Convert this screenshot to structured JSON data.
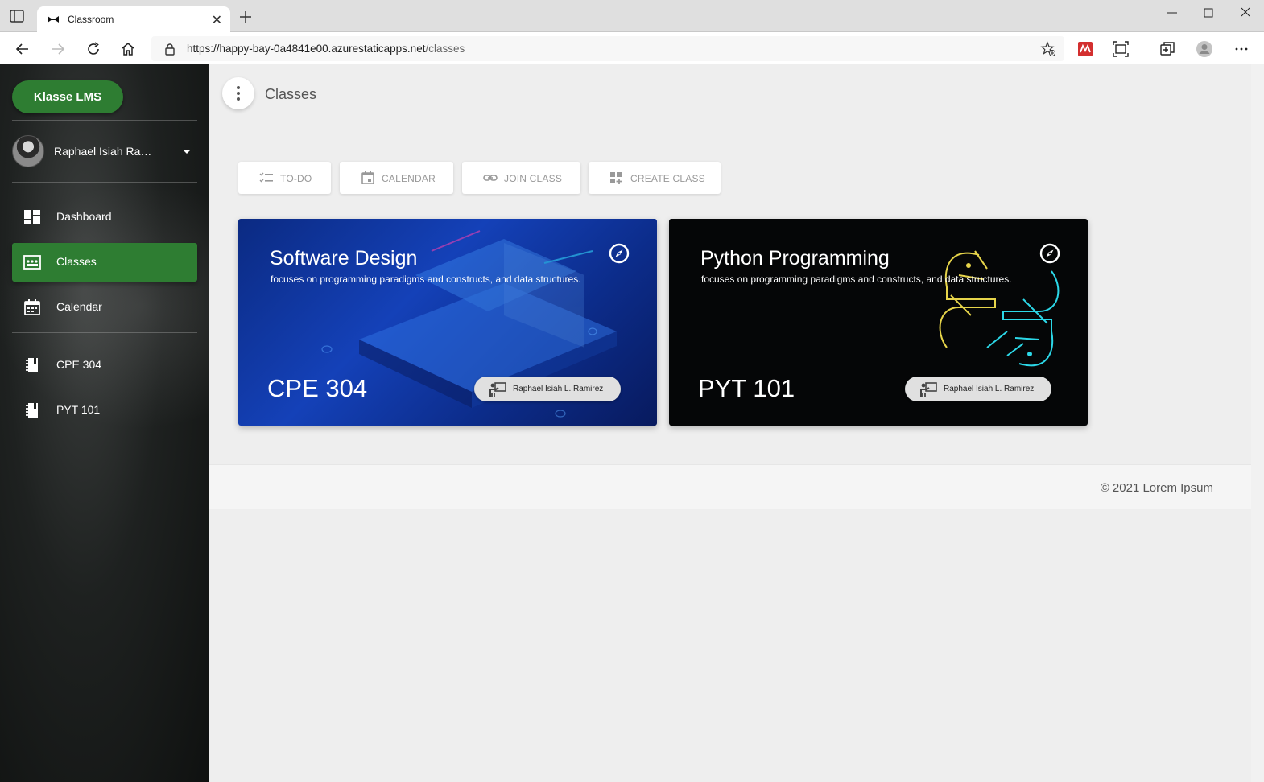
{
  "browser": {
    "tab_title": "Classroom",
    "url_host": "https://happy-bay-0a4841e00.azurestaticapps.net",
    "url_path": "/classes"
  },
  "sidebar": {
    "brand": "Klasse LMS",
    "user_name": "Raphael Isiah Rami...",
    "nav": [
      {
        "label": "Dashboard",
        "icon": "dashboard-icon"
      },
      {
        "label": "Classes",
        "icon": "classes-icon",
        "active": true
      },
      {
        "label": "Calendar",
        "icon": "calendar-icon"
      }
    ],
    "classes": [
      {
        "label": "CPE 304",
        "icon": "book-icon"
      },
      {
        "label": "PYT 101",
        "icon": "book-icon"
      }
    ]
  },
  "header": {
    "title": "Classes"
  },
  "actions": [
    {
      "label": "TO-DO",
      "icon": "todo-list-icon"
    },
    {
      "label": "CALENDAR",
      "icon": "calendar-icon"
    },
    {
      "label": "JOIN CLASS",
      "icon": "link-icon"
    },
    {
      "label": "CREATE CLASS",
      "icon": "create-grid-icon"
    }
  ],
  "cards": [
    {
      "title": "Software Design",
      "description": "focuses on programming paradigms and constructs, and data structures.",
      "code": "CPE 304",
      "teacher": "Raphael Isiah L. Ramirez"
    },
    {
      "title": "Python Programming",
      "description": "focuses on programming paradigms and constructs, and data structures.",
      "code": "PYT 101",
      "teacher": "Raphael Isiah L. Ramirez"
    }
  ],
  "footer": {
    "text": "© 2021 Lorem Ipsum"
  },
  "colors": {
    "accent": "#2e7d32",
    "sidebar_bg": "#1e2120",
    "content_bg": "#eeeeee"
  }
}
